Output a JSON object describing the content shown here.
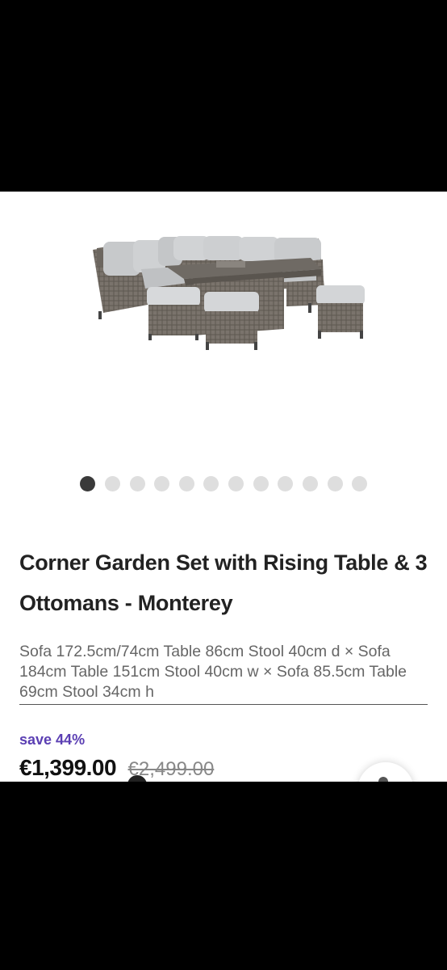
{
  "product": {
    "image_alt": "Corner Garden Set with Rising Table & 3 Ottomans - Monterey",
    "title": "Corner Garden Set with Rising Table & 3 Ottomans - Monterey",
    "dimensions": "Sofa 172.5cm/74cm Table 86cm Stool 40cm d × Sofa 184cm Table 151cm Stool 40cm w × Sofa 85.5cm Table 69cm Stool 34cm h",
    "save_label": "save 44%",
    "price": "€1,399.00",
    "was_price": "€2,499.00"
  },
  "gallery": {
    "image_count": 12,
    "active_index": 0
  },
  "colors": {
    "accent": "#5b3fb3",
    "dot_active": "#3a3a3a",
    "dot_inactive": "#dedede"
  },
  "icons": {
    "chat": "chat-icon"
  }
}
